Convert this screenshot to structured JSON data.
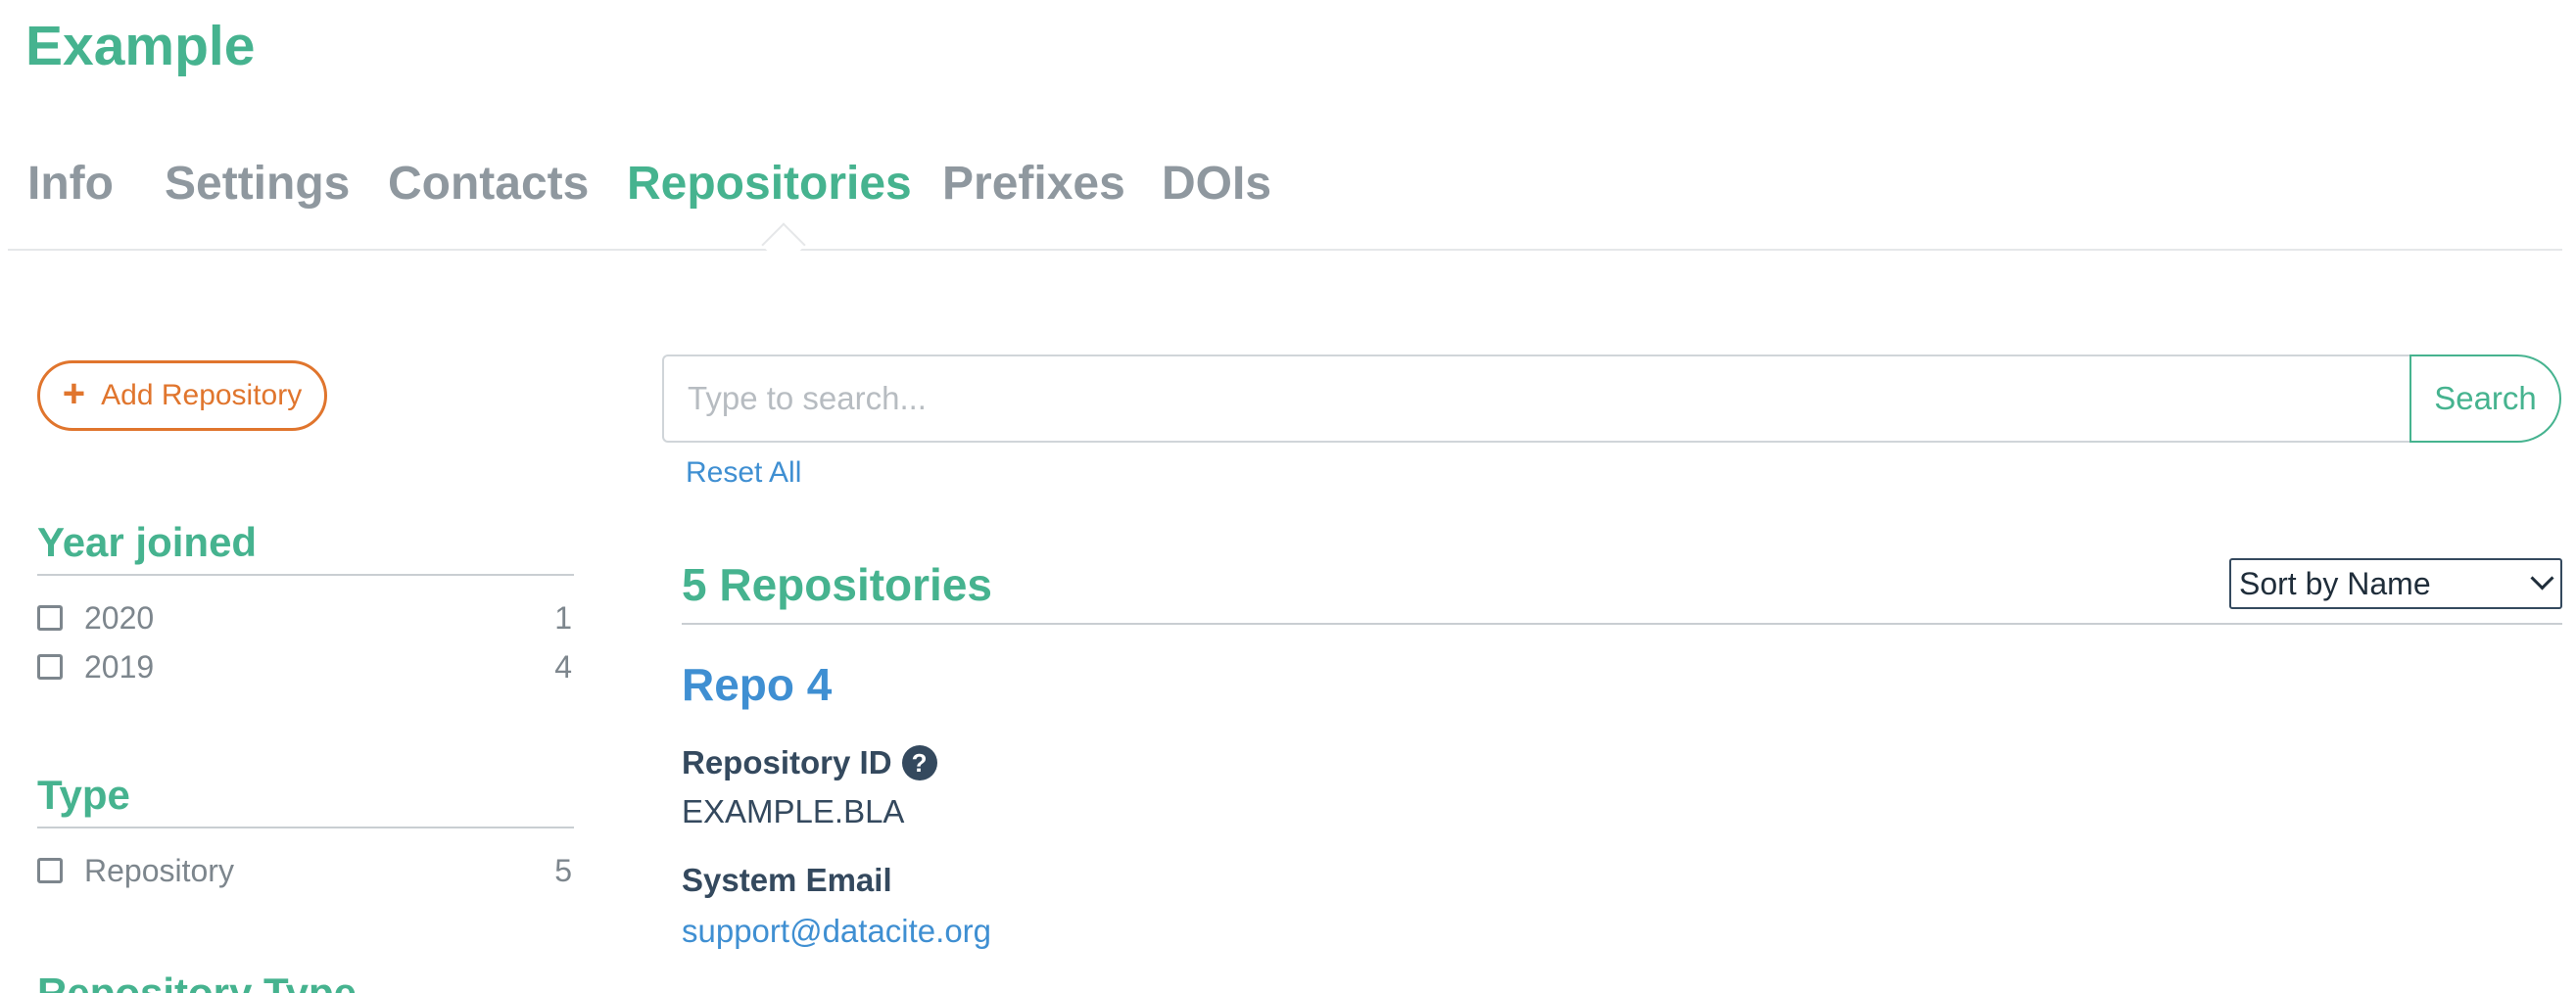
{
  "header": {
    "title": "Example"
  },
  "tabs": [
    {
      "label": "Info",
      "active": false
    },
    {
      "label": "Settings",
      "active": false
    },
    {
      "label": "Contacts",
      "active": false
    },
    {
      "label": "Repositories",
      "active": true
    },
    {
      "label": "Prefixes",
      "active": false
    },
    {
      "label": "DOIs",
      "active": false
    }
  ],
  "sidebar": {
    "add_button_label": "Add Repository",
    "facets": [
      {
        "title": "Year joined",
        "items": [
          {
            "label": "2020",
            "count": "1"
          },
          {
            "label": "2019",
            "count": "4"
          }
        ]
      },
      {
        "title": "Type",
        "items": [
          {
            "label": "Repository",
            "count": "5"
          }
        ]
      }
    ],
    "next_facet_title": "Repository Type"
  },
  "search": {
    "placeholder": "Type to search...",
    "value": "",
    "button_label": "Search",
    "reset_label": "Reset All"
  },
  "results": {
    "title": "5 Repositories",
    "sort_selected": "Sort by Name"
  },
  "repository": {
    "name": "Repo 4",
    "fields": [
      {
        "label": "Repository ID",
        "value": "EXAMPLE.BLA",
        "help": true,
        "link": false
      },
      {
        "label": "System Email",
        "value": "support@datacite.org",
        "help": false,
        "link": true
      }
    ]
  },
  "colors": {
    "brand_green": "#46b38f",
    "link_blue": "#3f8fd2",
    "accent_orange": "#e0752d",
    "muted_gray": "#8f989f",
    "text_dark": "#34495e"
  }
}
